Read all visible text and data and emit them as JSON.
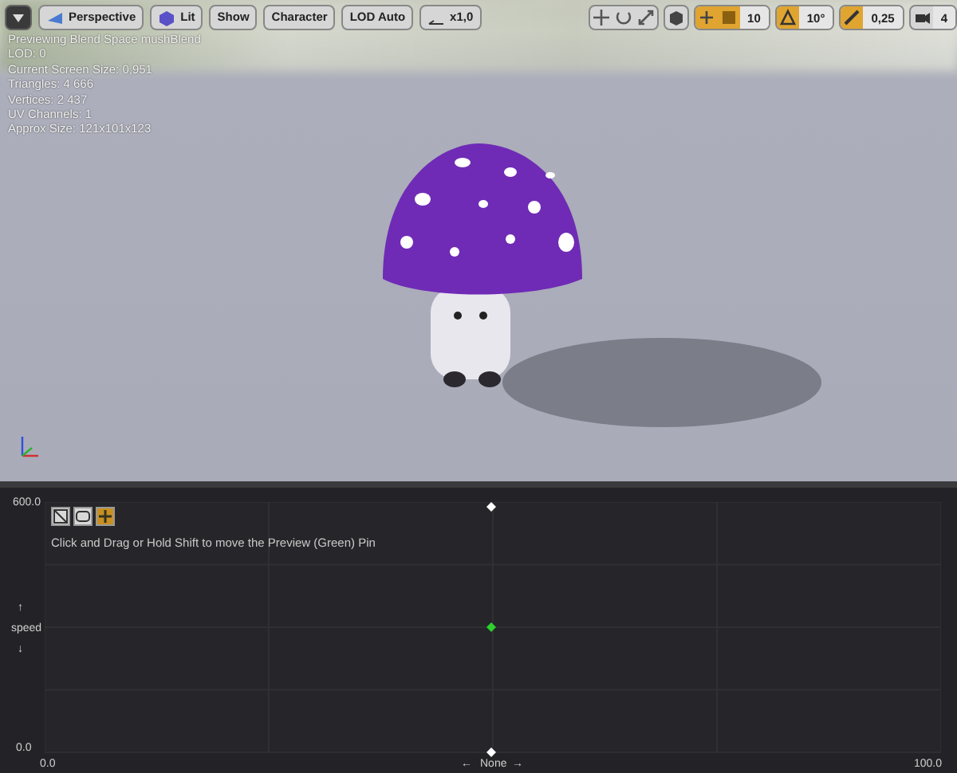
{
  "viewport": {
    "toolbar": [
      {
        "kind": "menu"
      },
      {
        "kind": "perspective",
        "label": "Perspective"
      },
      {
        "kind": "lit",
        "label": "Lit"
      },
      {
        "kind": "plain",
        "label": "Show"
      },
      {
        "kind": "plain",
        "label": "Character"
      },
      {
        "kind": "plain",
        "label": "LOD Auto"
      },
      {
        "kind": "speed",
        "label": "x1,0"
      }
    ],
    "right_toolbar": [
      {
        "kind": "transform_tools"
      },
      {
        "kind": "surface_snap",
        "on": false
      },
      {
        "kind": "grid_snap",
        "on": true,
        "value": "10"
      },
      {
        "kind": "rotate_snap",
        "on": true,
        "value": "10°"
      },
      {
        "kind": "scale_snap",
        "on": true,
        "value": "0,25"
      },
      {
        "kind": "camera_speed",
        "value": "4"
      }
    ],
    "info_lines": [
      "Previewing Blend Space mushBlend",
      "LOD: 0",
      "Current Screen Size: 0,951",
      "Triangles: 4 666",
      "Vertices: 2 437",
      "UV Channels: 1",
      "Approx Size: 121x101x123"
    ]
  },
  "blend_space": {
    "tools": [
      {
        "kind": "grid",
        "on": false
      },
      {
        "kind": "triangulation",
        "on": false
      },
      {
        "kind": "samples",
        "on": true
      }
    ],
    "hint": "Click and Drag or Hold Shift to move the Preview (Green) Pin",
    "y_axis": {
      "max": "600.0",
      "min": "0.0",
      "label": "speed",
      "up_arrow": "↑",
      "down_arrow": "↓"
    },
    "x_axis": {
      "min": "0.0",
      "max": "100.0",
      "label": "None",
      "left_arrow": "←",
      "right_arrow": "→"
    }
  }
}
